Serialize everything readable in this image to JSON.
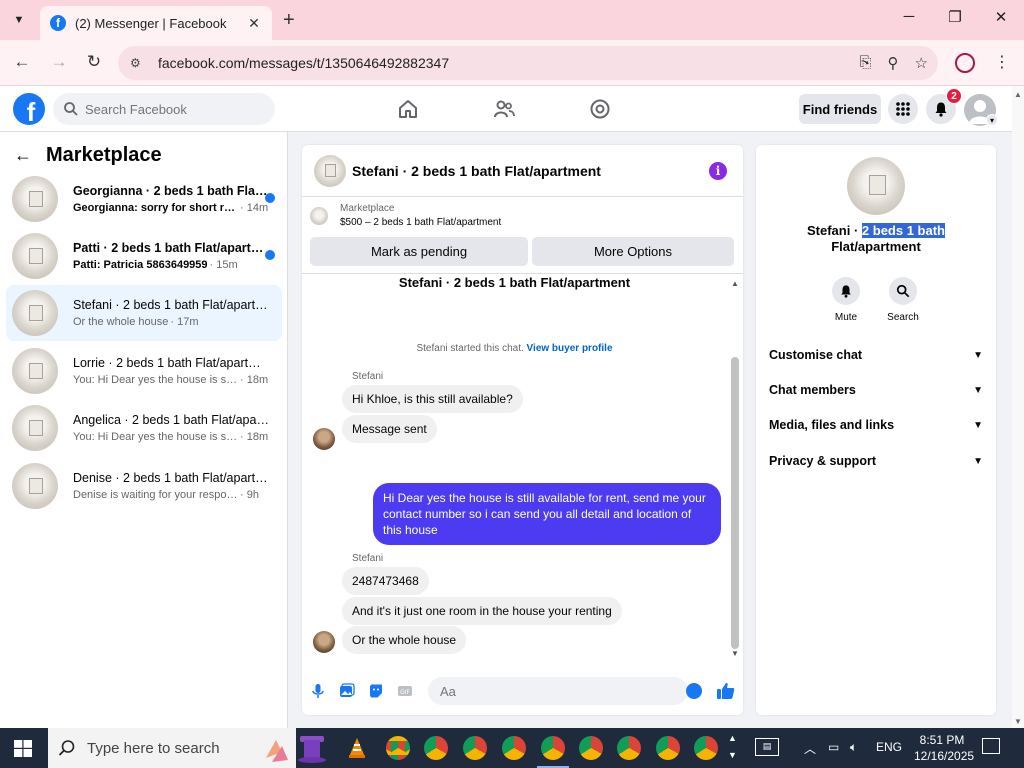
{
  "browser": {
    "tab_title": "(2) Messenger | Facebook",
    "url": "facebook.com/messages/t/1350646492882347"
  },
  "fb": {
    "search_placeholder": "Search Facebook",
    "find_friends": "Find friends",
    "notification_count": "2"
  },
  "left": {
    "title": "Marketplace",
    "conversations": [
      {
        "name": "Georgianna · 2 beds 1 bath Flat/a...",
        "preview": "Georgianna: sorry for short resp...",
        "time": "· 14m",
        "unread": true
      },
      {
        "name": "Patti · 2 beds 1 bath Flat/apartm...",
        "preview": "Patti: Patricia 5863649959",
        "time": "· 15m",
        "unread": true
      },
      {
        "name": "Stefani · 2 beds 1 bath Flat/apartm...",
        "preview": "Or the whole house",
        "time": "· 17m",
        "unread": false
      },
      {
        "name": "Lorrie · 2 beds 1 bath Flat/apartment",
        "preview": "You: Hi Dear yes the house is still av...",
        "time": "· 18m",
        "unread": false
      },
      {
        "name": "Angelica · 2 beds 1 bath Flat/apart...",
        "preview": "You: Hi Dear yes the house is still av...",
        "time": "· 18m",
        "unread": false
      },
      {
        "name": "Denise · 2 beds 1 bath Flat/apartm...",
        "preview": "Denise is waiting for your response.",
        "time": "· 9h",
        "unread": false
      }
    ]
  },
  "chat": {
    "title": "Stefani · 2 beds 1 bath Flat/apartment",
    "marketplace_label": "Marketplace",
    "listing": "$500 – 2 beds 1 bath Flat/apartment",
    "mark_pending": "Mark as pending",
    "more_options": "More Options",
    "subject": "Stefani · 2 beds 1 bath Flat/apartment",
    "system_text": "Stefani started this chat.",
    "system_link": "View buyer profile",
    "sender1": "Stefani",
    "msg1": "Hi Khloe, is this still available?",
    "msg2": "Message sent",
    "msg_out": "Hi Dear yes the house is still available for rent, send me your contact number so i can send you all detail and location of this house",
    "sender2": "Stefani",
    "msg3": "2487473468",
    "msg4": "And it's it just one room in the house your renting",
    "msg5": "Or the whole house",
    "composer_placeholder": "Aa"
  },
  "right": {
    "name_plain": "Stefani · ",
    "name_selected": "2 beds 1 bath",
    "name_line2": "Flat/apartment",
    "mute": "Mute",
    "search": "Search",
    "rows": [
      "Customise chat",
      "Chat members",
      "Media, files and links",
      "Privacy & support"
    ]
  },
  "taskbar": {
    "search_placeholder": "Type here to search",
    "lang": "ENG",
    "time": "8:51 PM",
    "date": "12/16/2025"
  },
  "colors": {
    "fb_blue": "#1877f2",
    "outgoing_bubble": "#4d3bf2",
    "info_purple": "#8a2be2",
    "unread_dot": "#1877f2"
  }
}
